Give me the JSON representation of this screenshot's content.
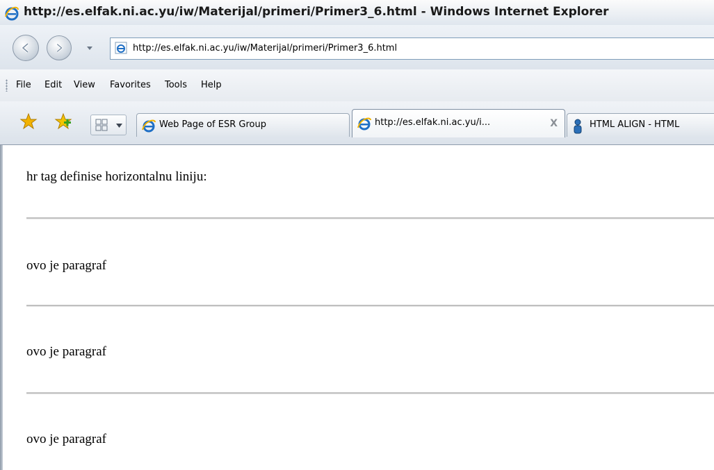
{
  "window": {
    "title": "http://es.elfak.ni.ac.yu/iw/Materijal/primeri/Primer3_6.html - Windows Internet Explorer"
  },
  "address_bar": {
    "url": "http://es.elfak.ni.ac.yu/iw/Materijal/primeri/Primer3_6.html"
  },
  "menu": {
    "items": [
      "File",
      "Edit",
      "View",
      "Favorites",
      "Tools",
      "Help"
    ]
  },
  "tabs": [
    {
      "label": "Web Page of ESR Group",
      "active": false,
      "icon": "ie-icon"
    },
    {
      "label": "http://es.elfak.ni.ac.yu/i...",
      "active": true,
      "icon": "ie-icon",
      "close": "X"
    },
    {
      "label": "HTML ALIGN - HTML",
      "active": false,
      "icon": "person-icon"
    }
  ],
  "page": {
    "heading_line": "hr tag definise horizontalnu liniju:",
    "paragraphs": [
      "ovo je paragraf",
      "ovo je paragraf",
      "ovo je paragraf"
    ]
  },
  "colors": {
    "ie_blue": "#1f6fc5",
    "star_gold": "#f2b200",
    "star_green": "#3aa020"
  }
}
